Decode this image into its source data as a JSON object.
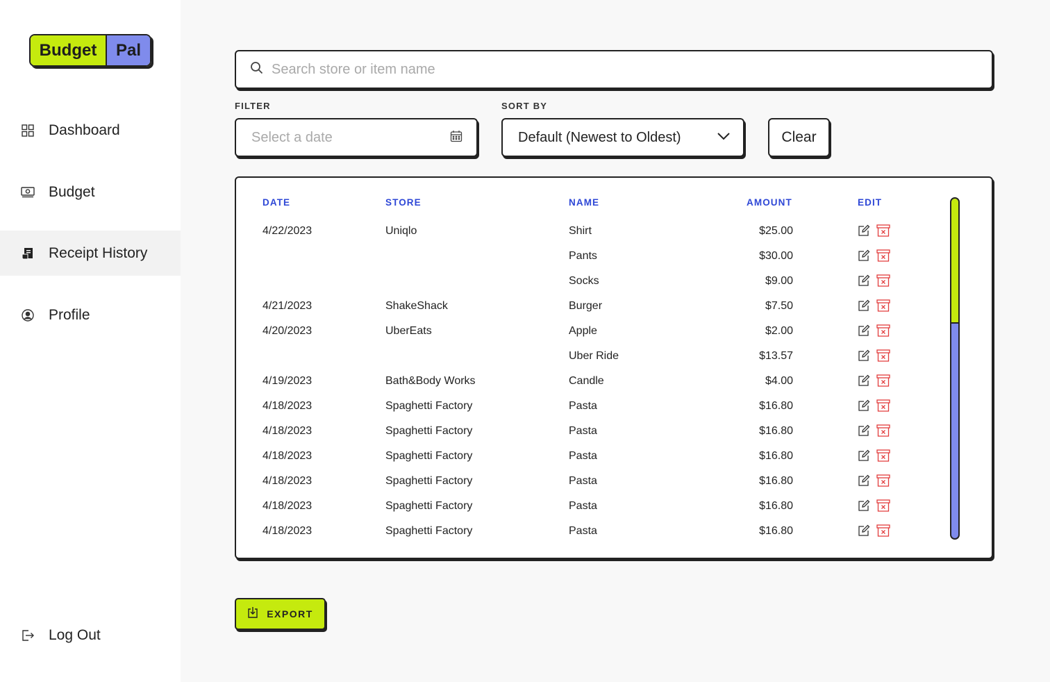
{
  "brand": {
    "part1": "Budget",
    "part2": "Pal",
    "color1": "#c5ea0e",
    "color2": "#7f8bec"
  },
  "sidebar": {
    "items": [
      {
        "label": "Dashboard",
        "icon": "grid-icon"
      },
      {
        "label": "Budget",
        "icon": "money-icon"
      },
      {
        "label": "Receipt History",
        "icon": "receipt-icon",
        "active": true
      },
      {
        "label": "Profile",
        "icon": "user-icon"
      }
    ],
    "logout": {
      "label": "Log Out",
      "icon": "logout-icon"
    }
  },
  "search": {
    "placeholder": "Search store or item name"
  },
  "filter": {
    "label": "FILTER",
    "placeholder": "Select a date"
  },
  "sort": {
    "label": "SORT BY",
    "value": "Default (Newest to Oldest)"
  },
  "clear_label": "Clear",
  "table": {
    "headers": {
      "date": "DATE",
      "store": "STORE",
      "name": "NAME",
      "amount": "AMOUNT",
      "edit": "EDIT"
    },
    "rows": [
      {
        "date": "4/22/2023",
        "store": "Uniqlo",
        "name": "Shirt",
        "amount": "$25.00"
      },
      {
        "date": "",
        "store": "",
        "name": "Pants",
        "amount": "$30.00"
      },
      {
        "date": "",
        "store": "",
        "name": "Socks",
        "amount": "$9.00"
      },
      {
        "date": "4/21/2023",
        "store": "ShakeShack",
        "name": "Burger",
        "amount": "$7.50"
      },
      {
        "date": "4/20/2023",
        "store": "UberEats",
        "name": "Apple",
        "amount": "$2.00"
      },
      {
        "date": "",
        "store": "",
        "name": "Uber Ride",
        "amount": "$13.57"
      },
      {
        "date": "4/19/2023",
        "store": "Bath&Body Works",
        "name": "Candle",
        "amount": "$4.00"
      },
      {
        "date": "4/18/2023",
        "store": "Spaghetti Factory",
        "name": "Pasta",
        "amount": "$16.80"
      },
      {
        "date": "4/18/2023",
        "store": "Spaghetti Factory",
        "name": "Pasta",
        "amount": "$16.80"
      },
      {
        "date": "4/18/2023",
        "store": "Spaghetti Factory",
        "name": "Pasta",
        "amount": "$16.80"
      },
      {
        "date": "4/18/2023",
        "store": "Spaghetti Factory",
        "name": "Pasta",
        "amount": "$16.80"
      },
      {
        "date": "4/18/2023",
        "store": "Spaghetti Factory",
        "name": "Pasta",
        "amount": "$16.80"
      },
      {
        "date": "4/18/2023",
        "store": "Spaghetti Factory",
        "name": "Pasta",
        "amount": "$16.80"
      }
    ],
    "scroll_position_fraction": 0.0
  },
  "export_label": "EXPORT",
  "colors": {
    "accent_blue": "#2e47d6",
    "delete_red": "#e23b3b",
    "lime": "#c5ea0e",
    "periwinkle": "#7f8bec"
  }
}
